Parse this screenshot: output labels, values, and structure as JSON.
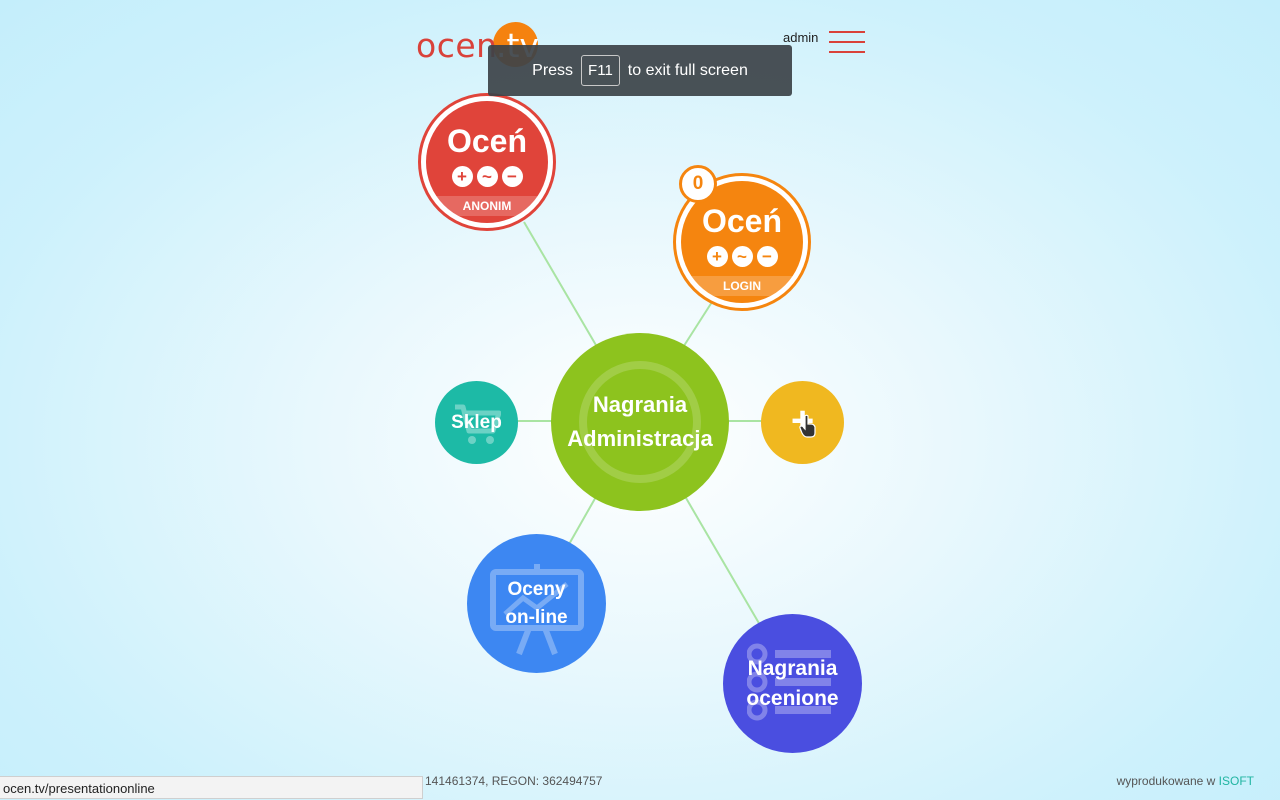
{
  "header": {
    "logo_text": "ocen",
    "logo_tv": ".tv",
    "user": "admin"
  },
  "fullscreen_toast": {
    "before": "Press",
    "key": "F11",
    "after": "to exit full screen"
  },
  "nodes": {
    "center": {
      "line1": "Nagrania",
      "line2": "Administracja"
    },
    "rate_anon": {
      "title": "Oceń",
      "band": "ANONIM",
      "icons": [
        "+",
        "~",
        "−"
      ]
    },
    "rate_login": {
      "title": "Oceń",
      "band": "LOGIN",
      "badge": "0",
      "icons": [
        "+",
        "~",
        "−"
      ]
    },
    "shop": {
      "label": "Sklep"
    },
    "add": {
      "label": "+"
    },
    "online": {
      "line1": "Oceny",
      "line2": "on-line"
    },
    "rated": {
      "line1": "Nagrania",
      "line2": "ocenione"
    }
  },
  "footer": {
    "left": "141461374, REGON: 362494757",
    "right_text": "wyprodukowane w",
    "right_brand": "ISOFT"
  },
  "status_bar": {
    "url": "ocen.tv/presentationonline"
  },
  "colors": {
    "red": "#e0443a",
    "orange": "#f5850f",
    "green": "#8dc31e",
    "teal": "#1dbaa6",
    "yellow": "#f0b820",
    "blue": "#3d87f2",
    "indigo": "#4a4ee0"
  }
}
